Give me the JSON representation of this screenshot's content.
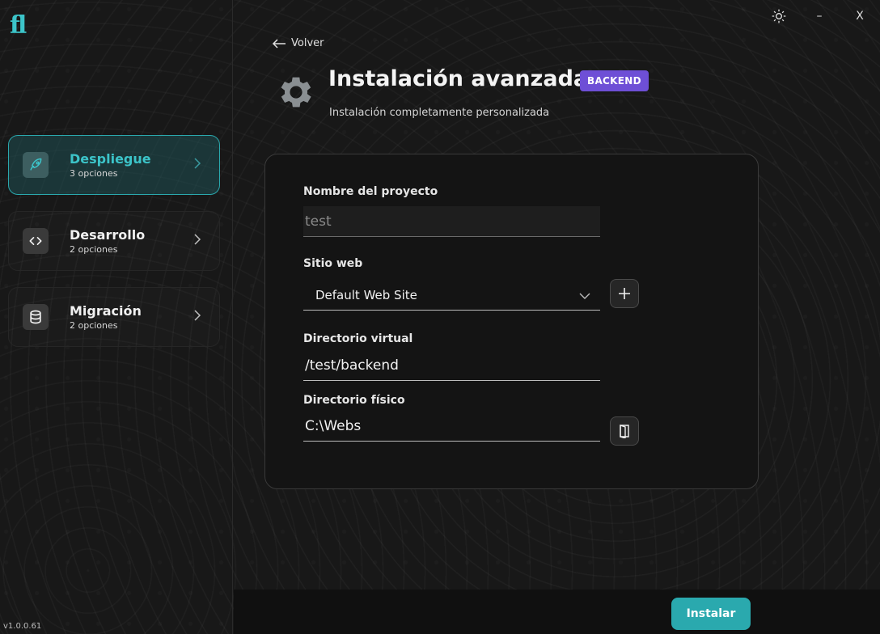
{
  "app": {
    "logo": "fl",
    "version": "v1.0.0.61"
  },
  "sidebar": {
    "items": [
      {
        "title": "Despliegue",
        "subtitle": "3 opciones",
        "icon": "rocket-icon",
        "active": true
      },
      {
        "title": "Desarrollo",
        "subtitle": "2 opciones",
        "icon": "code-icon",
        "active": false
      },
      {
        "title": "Migración",
        "subtitle": "2 opciones",
        "icon": "database-icon",
        "active": false
      }
    ]
  },
  "window": {
    "minimize": "–",
    "close": "X",
    "theme_icon": "sun-icon"
  },
  "header": {
    "back_label": "Volver",
    "title": "Instalación avanzada",
    "badge": "BACKEND",
    "subtitle": "Instalación completamente personalizada"
  },
  "form": {
    "project_name": {
      "label": "Nombre del proyecto",
      "value": "test"
    },
    "website": {
      "label": "Sitio web",
      "value": "Default Web Site"
    },
    "virtual_dir": {
      "label": "Directorio virtual",
      "value": "/test/backend"
    },
    "physical_dir": {
      "label": "Directorio físico",
      "value": "C:\\Webs"
    }
  },
  "footer": {
    "install_label": "Instalar"
  },
  "colors": {
    "accent": "#2aa9ae",
    "badge": "#6e4fd6"
  }
}
